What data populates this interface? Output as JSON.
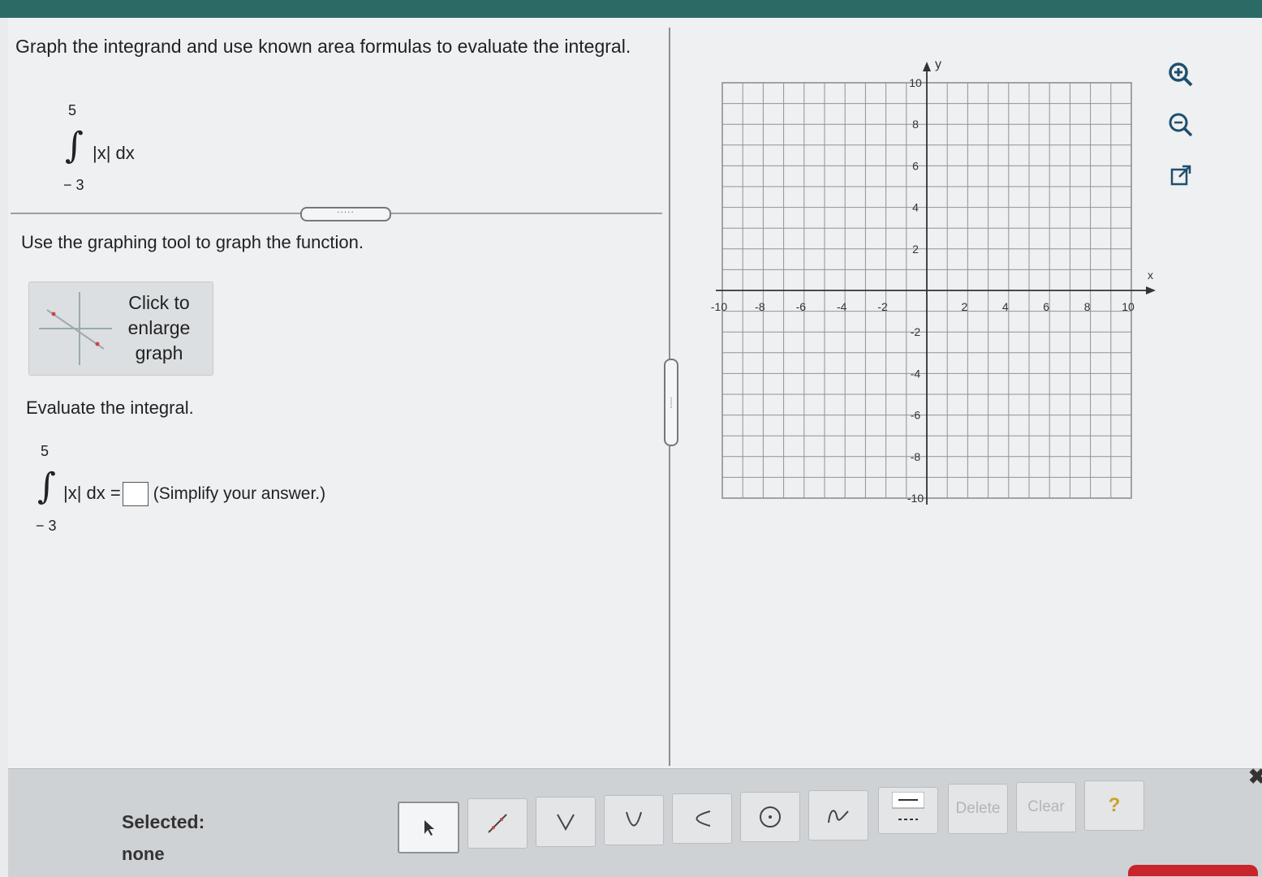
{
  "question": {
    "text": "Graph the integrand and use known area formulas to evaluate the integral.",
    "integral": {
      "upper": "5",
      "lower": "− 3",
      "integrand": "|x| dx"
    }
  },
  "instruction": "Use the graphing tool to graph the function.",
  "enlarge_button": {
    "label": "Click to enlarge graph"
  },
  "evaluate": {
    "label": "Evaluate the integral.",
    "integral": {
      "upper": "5",
      "lower": "− 3",
      "integrand": "|x| dx ="
    },
    "answer_value": "",
    "hint": "(Simplify your answer.)"
  },
  "graph": {
    "x_label": "x",
    "y_label": "y",
    "x_ticks": [
      "-10",
      "-8",
      "-6",
      "-4",
      "-2",
      "2",
      "4",
      "6",
      "8",
      "10"
    ],
    "y_ticks": [
      "10",
      "8",
      "6",
      "4",
      "2",
      "-2",
      "-4",
      "-6",
      "-8",
      "-10"
    ],
    "xlim": [
      -10,
      10
    ],
    "ylim": [
      -10,
      10
    ],
    "minor_step": 1,
    "label_step": 2
  },
  "side_tools": [
    "zoom-in-icon",
    "zoom-out-icon",
    "pop-out-icon"
  ],
  "toolbar": {
    "selected_label": "Selected:",
    "selected_value": "none",
    "tools": [
      "pointer",
      "line",
      "absolute-value",
      "parabola",
      "horizontal-parabola",
      "circle",
      "curve",
      "line-style"
    ],
    "delete_label": "Delete",
    "clear_label": "Clear",
    "help_label": "?",
    "close_label": "✖"
  },
  "colors": {
    "accent_bar": "#2b6b66",
    "help": "#c9a227",
    "red": "#c7252b"
  }
}
